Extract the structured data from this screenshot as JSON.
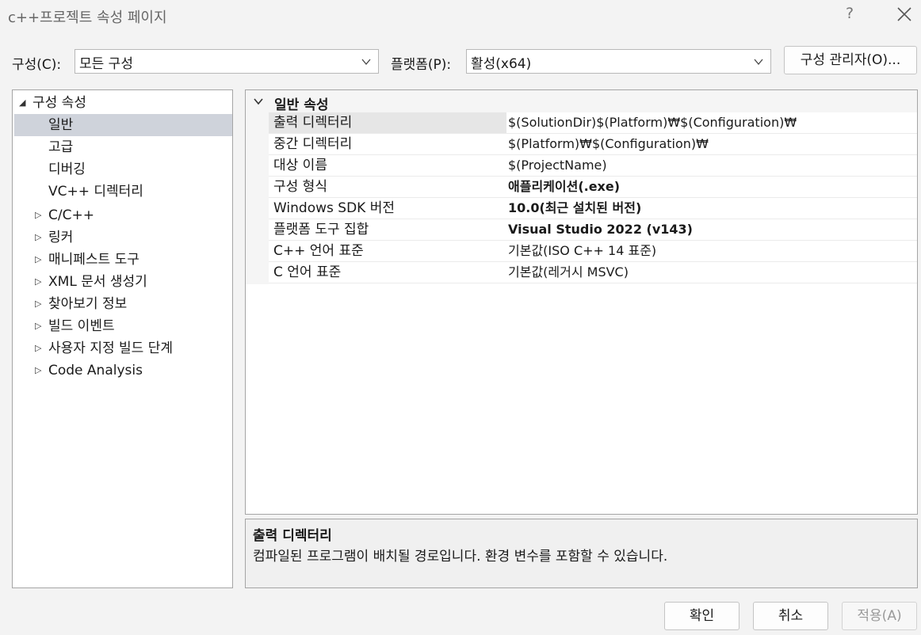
{
  "window": {
    "title": "c++프로젝트 속성 페이지",
    "help_label": "?"
  },
  "toolbar": {
    "config_label": "구성(C):",
    "config_value": "모든 구성",
    "platform_label": "플랫폼(P):",
    "platform_value": "활성(x64)",
    "config_manager_label": "구성 관리자(O)..."
  },
  "tree": {
    "root": "구성 속성",
    "children": [
      {
        "label": "일반",
        "expandable": false,
        "selected": true
      },
      {
        "label": "고급",
        "expandable": false
      },
      {
        "label": "디버깅",
        "expandable": false
      },
      {
        "label": "VC++ 디렉터리",
        "expandable": false
      },
      {
        "label": "C/C++",
        "expandable": true
      },
      {
        "label": "링커",
        "expandable": true
      },
      {
        "label": "매니페스트 도구",
        "expandable": true
      },
      {
        "label": "XML 문서 생성기",
        "expandable": true
      },
      {
        "label": "찾아보기 정보",
        "expandable": true
      },
      {
        "label": "빌드 이벤트",
        "expandable": true
      },
      {
        "label": "사용자 지정 빌드 단계",
        "expandable": true
      },
      {
        "label": "Code Analysis",
        "expandable": true
      }
    ]
  },
  "grid": {
    "section_title": "일반 속성",
    "rows": [
      {
        "name": "출력 디렉터리",
        "value": "$(SolutionDir)$(Platform)₩$(Configuration)₩",
        "bold": false
      },
      {
        "name": "중간 디렉터리",
        "value": "$(Platform)₩$(Configuration)₩",
        "bold": false
      },
      {
        "name": "대상 이름",
        "value": "$(ProjectName)",
        "bold": false
      },
      {
        "name": "구성 형식",
        "value": "애플리케이션(.exe)",
        "bold": true
      },
      {
        "name": "Windows SDK 버전",
        "value": "10.0(최근 설치된 버전)",
        "bold": true
      },
      {
        "name": "플랫폼 도구 집합",
        "value": "Visual Studio 2022 (v143)",
        "bold": true
      },
      {
        "name": "C++ 언어 표준",
        "value": "기본값(ISO C++ 14 표준)",
        "bold": false
      },
      {
        "name": "C 언어 표준",
        "value": "기본값(레거시 MSVC)",
        "bold": false
      }
    ]
  },
  "description": {
    "title": "출력 디렉터리",
    "text": "컴파일된 프로그램이 배치될 경로입니다. 환경 변수를 포함할 수 있습니다."
  },
  "buttons": {
    "ok": "확인",
    "cancel": "취소",
    "apply": "적용(A)"
  }
}
